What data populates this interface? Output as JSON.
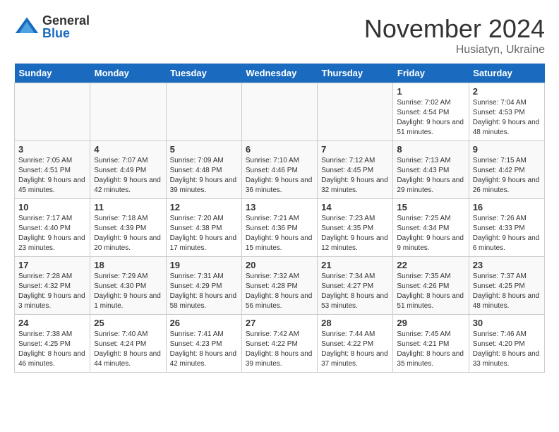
{
  "header": {
    "logo_general": "General",
    "logo_blue": "Blue",
    "month_title": "November 2024",
    "location": "Husiatyn, Ukraine"
  },
  "days_of_week": [
    "Sunday",
    "Monday",
    "Tuesday",
    "Wednesday",
    "Thursday",
    "Friday",
    "Saturday"
  ],
  "weeks": [
    [
      {
        "day": "",
        "info": ""
      },
      {
        "day": "",
        "info": ""
      },
      {
        "day": "",
        "info": ""
      },
      {
        "day": "",
        "info": ""
      },
      {
        "day": "",
        "info": ""
      },
      {
        "day": "1",
        "info": "Sunrise: 7:02 AM\nSunset: 4:54 PM\nDaylight: 9 hours and 51 minutes."
      },
      {
        "day": "2",
        "info": "Sunrise: 7:04 AM\nSunset: 4:53 PM\nDaylight: 9 hours and 48 minutes."
      }
    ],
    [
      {
        "day": "3",
        "info": "Sunrise: 7:05 AM\nSunset: 4:51 PM\nDaylight: 9 hours and 45 minutes."
      },
      {
        "day": "4",
        "info": "Sunrise: 7:07 AM\nSunset: 4:49 PM\nDaylight: 9 hours and 42 minutes."
      },
      {
        "day": "5",
        "info": "Sunrise: 7:09 AM\nSunset: 4:48 PM\nDaylight: 9 hours and 39 minutes."
      },
      {
        "day": "6",
        "info": "Sunrise: 7:10 AM\nSunset: 4:46 PM\nDaylight: 9 hours and 36 minutes."
      },
      {
        "day": "7",
        "info": "Sunrise: 7:12 AM\nSunset: 4:45 PM\nDaylight: 9 hours and 32 minutes."
      },
      {
        "day": "8",
        "info": "Sunrise: 7:13 AM\nSunset: 4:43 PM\nDaylight: 9 hours and 29 minutes."
      },
      {
        "day": "9",
        "info": "Sunrise: 7:15 AM\nSunset: 4:42 PM\nDaylight: 9 hours and 26 minutes."
      }
    ],
    [
      {
        "day": "10",
        "info": "Sunrise: 7:17 AM\nSunset: 4:40 PM\nDaylight: 9 hours and 23 minutes."
      },
      {
        "day": "11",
        "info": "Sunrise: 7:18 AM\nSunset: 4:39 PM\nDaylight: 9 hours and 20 minutes."
      },
      {
        "day": "12",
        "info": "Sunrise: 7:20 AM\nSunset: 4:38 PM\nDaylight: 9 hours and 17 minutes."
      },
      {
        "day": "13",
        "info": "Sunrise: 7:21 AM\nSunset: 4:36 PM\nDaylight: 9 hours and 15 minutes."
      },
      {
        "day": "14",
        "info": "Sunrise: 7:23 AM\nSunset: 4:35 PM\nDaylight: 9 hours and 12 minutes."
      },
      {
        "day": "15",
        "info": "Sunrise: 7:25 AM\nSunset: 4:34 PM\nDaylight: 9 hours and 9 minutes."
      },
      {
        "day": "16",
        "info": "Sunrise: 7:26 AM\nSunset: 4:33 PM\nDaylight: 9 hours and 6 minutes."
      }
    ],
    [
      {
        "day": "17",
        "info": "Sunrise: 7:28 AM\nSunset: 4:32 PM\nDaylight: 9 hours and 3 minutes."
      },
      {
        "day": "18",
        "info": "Sunrise: 7:29 AM\nSunset: 4:30 PM\nDaylight: 9 hours and 1 minute."
      },
      {
        "day": "19",
        "info": "Sunrise: 7:31 AM\nSunset: 4:29 PM\nDaylight: 8 hours and 58 minutes."
      },
      {
        "day": "20",
        "info": "Sunrise: 7:32 AM\nSunset: 4:28 PM\nDaylight: 8 hours and 56 minutes."
      },
      {
        "day": "21",
        "info": "Sunrise: 7:34 AM\nSunset: 4:27 PM\nDaylight: 8 hours and 53 minutes."
      },
      {
        "day": "22",
        "info": "Sunrise: 7:35 AM\nSunset: 4:26 PM\nDaylight: 8 hours and 51 minutes."
      },
      {
        "day": "23",
        "info": "Sunrise: 7:37 AM\nSunset: 4:25 PM\nDaylight: 8 hours and 48 minutes."
      }
    ],
    [
      {
        "day": "24",
        "info": "Sunrise: 7:38 AM\nSunset: 4:25 PM\nDaylight: 8 hours and 46 minutes."
      },
      {
        "day": "25",
        "info": "Sunrise: 7:40 AM\nSunset: 4:24 PM\nDaylight: 8 hours and 44 minutes."
      },
      {
        "day": "26",
        "info": "Sunrise: 7:41 AM\nSunset: 4:23 PM\nDaylight: 8 hours and 42 minutes."
      },
      {
        "day": "27",
        "info": "Sunrise: 7:42 AM\nSunset: 4:22 PM\nDaylight: 8 hours and 39 minutes."
      },
      {
        "day": "28",
        "info": "Sunrise: 7:44 AM\nSunset: 4:22 PM\nDaylight: 8 hours and 37 minutes."
      },
      {
        "day": "29",
        "info": "Sunrise: 7:45 AM\nSunset: 4:21 PM\nDaylight: 8 hours and 35 minutes."
      },
      {
        "day": "30",
        "info": "Sunrise: 7:46 AM\nSunset: 4:20 PM\nDaylight: 8 hours and 33 minutes."
      }
    ]
  ]
}
